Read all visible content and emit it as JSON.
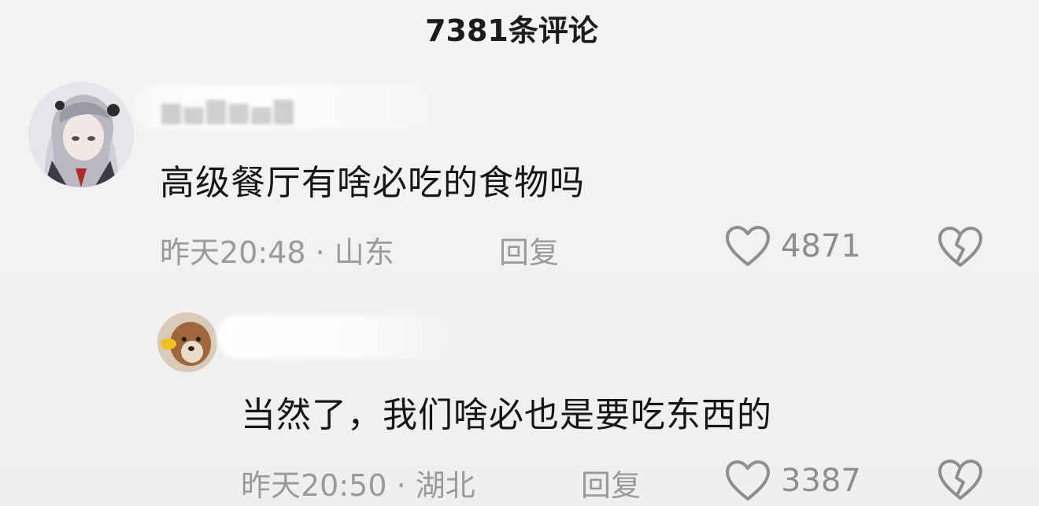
{
  "header": {
    "title": "7381条评论"
  },
  "comments": [
    {
      "text": "高级餐厅有啥必吃的食物吗",
      "meta": "昨天20:48 · 山东",
      "reply_label": "回复",
      "likes": "4871"
    },
    {
      "text": "当然了，我们啥必也是要吃东西的",
      "meta": "昨天20:50 · 湖北",
      "reply_label": "回复",
      "likes": "3387"
    }
  ],
  "icons": {
    "like": "heart-outline-icon",
    "dislike": "broken-heart-icon"
  },
  "colors": {
    "background": "#f2f2f2",
    "text": "#161616",
    "meta": "#9a9a9a"
  }
}
